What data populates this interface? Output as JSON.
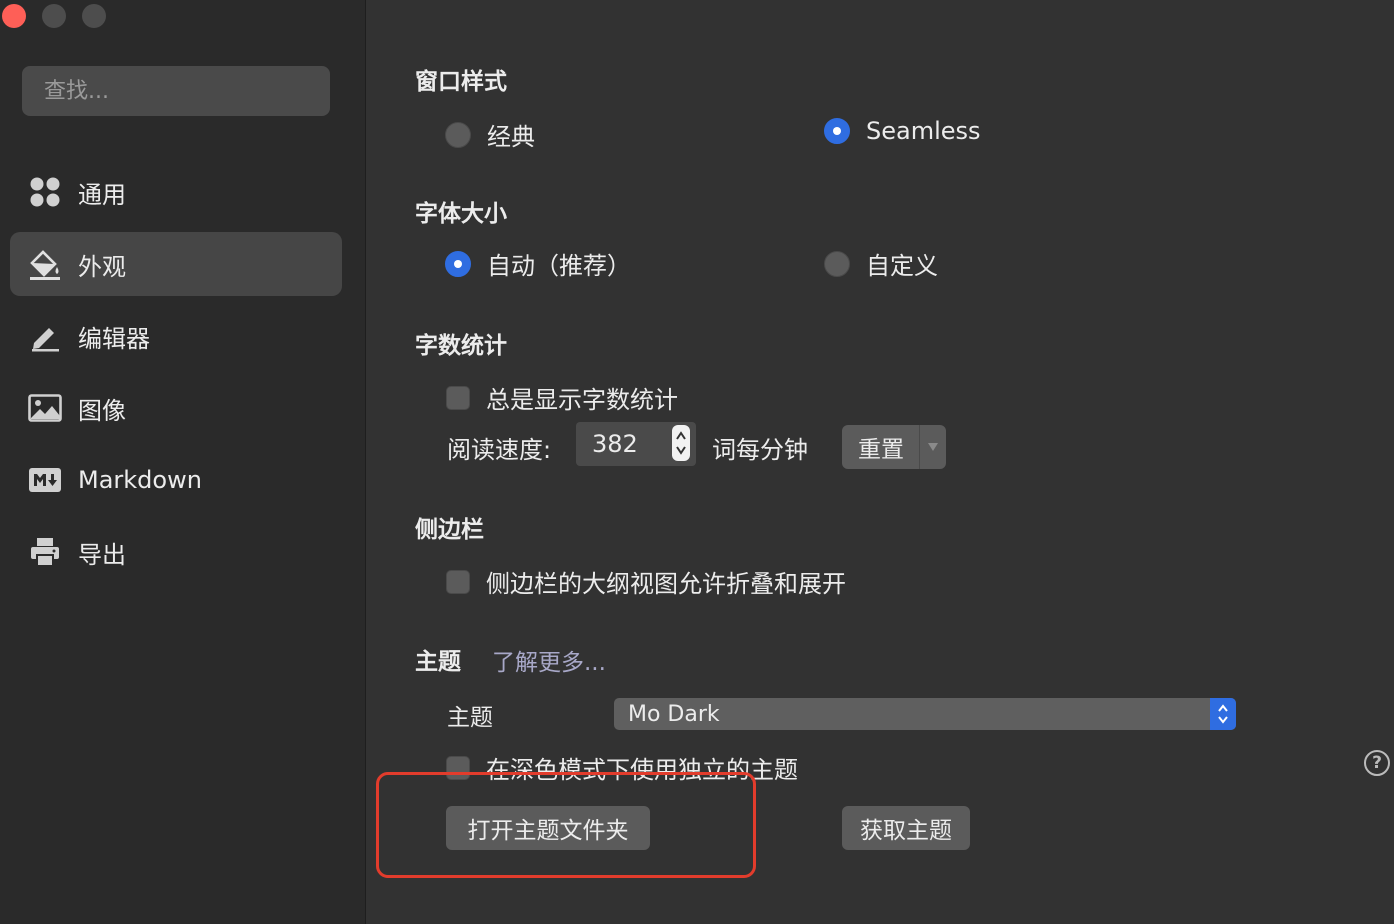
{
  "window": {
    "controls": [
      {
        "name": "close",
        "color": "#fe5f57"
      },
      {
        "name": "minimize",
        "color": "#4d4d4d"
      },
      {
        "name": "zoom",
        "color": "#4d4d4d"
      }
    ]
  },
  "sidebar": {
    "search_placeholder": "查找...",
    "items": [
      {
        "label": "通用",
        "icon": "grid-icon"
      },
      {
        "label": "外观",
        "icon": "paint-bucket-icon",
        "active": true
      },
      {
        "label": "编辑器",
        "icon": "pencil-icon"
      },
      {
        "label": "图像",
        "icon": "image-icon"
      },
      {
        "label": "Markdown",
        "icon": "markdown-icon"
      },
      {
        "label": "导出",
        "icon": "printer-icon"
      }
    ]
  },
  "window_style": {
    "title": "窗口样式",
    "options": [
      {
        "label": "经典",
        "selected": false
      },
      {
        "label": "Seamless",
        "selected": true
      }
    ]
  },
  "font_size": {
    "title": "字体大小",
    "options": [
      {
        "label": "自动（推荐）",
        "selected": true
      },
      {
        "label": "自定义",
        "selected": false
      }
    ]
  },
  "word_count": {
    "title": "字数统计",
    "always_show_label": "总是显示字数统计",
    "always_show_checked": false,
    "reading_speed_label": "阅读速度:",
    "reading_speed_value": "382",
    "unit_label": "词每分钟",
    "reset_label": "重置"
  },
  "sidebar_section": {
    "title": "侧边栏",
    "outline_label": "侧边栏的大纲视图允许折叠和展开",
    "outline_checked": false
  },
  "theme": {
    "title": "主题",
    "learn_more": "了解更多...",
    "theme_label": "主题",
    "selected_theme": "Mo Dark",
    "dark_mode_label": "在深色模式下使用独立的主题",
    "dark_mode_checked": false,
    "open_folder_label": "打开主题文件夹",
    "get_themes_label": "获取主题",
    "help": "?"
  },
  "colors": {
    "accent": "#2f6de1",
    "highlight_border": "#e23c2c"
  }
}
